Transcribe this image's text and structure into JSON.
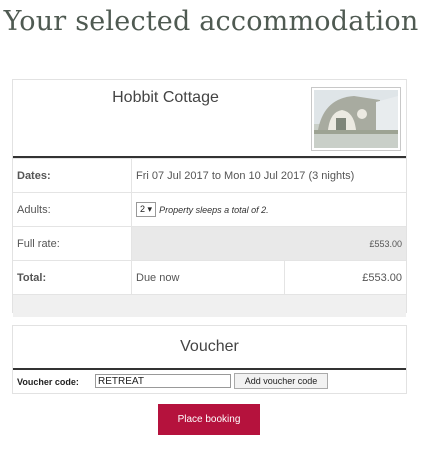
{
  "page": {
    "heading": "Your selected accommodation"
  },
  "accommodation": {
    "name": "Hobbit Cottage",
    "thumbnail_alt": "cottage-photo",
    "rows": {
      "dates": {
        "label": "Dates:",
        "value": "Fri 07 Jul 2017 to Mon 10 Jul 2017 (3 nights)"
      },
      "adults": {
        "label": "Adults:",
        "selected": "2",
        "note": "Property sleeps a total of 2."
      },
      "full_rate": {
        "label": "Full rate:",
        "value": "£553.00"
      },
      "total": {
        "label": "Total:",
        "due_label": "Due now",
        "value": "£553.00"
      }
    }
  },
  "voucher": {
    "title": "Voucher",
    "code_label": "Voucher code:",
    "code_value": "RETREAT",
    "add_button": "Add voucher code"
  },
  "actions": {
    "place_booking": "Place booking"
  },
  "colors": {
    "accent": "#b5123d",
    "heading": "#4f5a52"
  }
}
